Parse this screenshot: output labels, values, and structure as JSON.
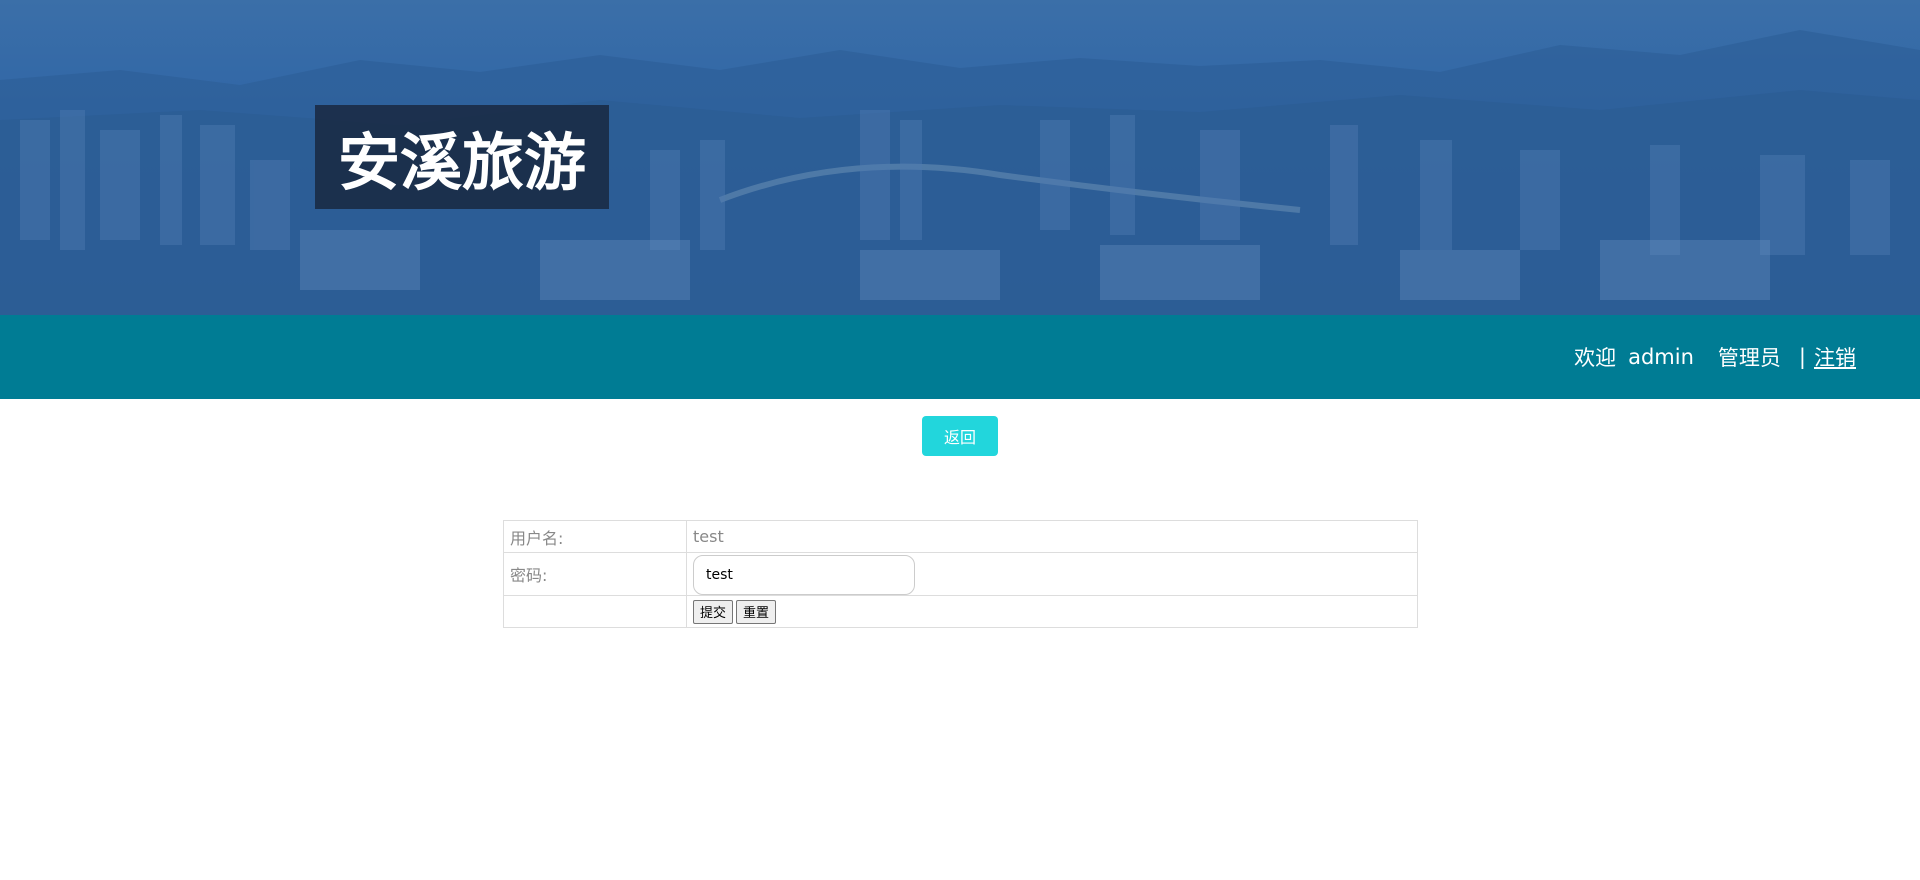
{
  "header": {
    "site_title": "安溪旅游"
  },
  "navbar": {
    "welcome_prefix": "欢迎",
    "username": "admin",
    "role": "管理员",
    "separator": "|",
    "logout_label": "注销"
  },
  "toolbar": {
    "back_label": "返回"
  },
  "form": {
    "username_label": "用户名:",
    "username_value": "test",
    "password_label": "密码:",
    "password_value": "test",
    "submit_label": "提交",
    "reset_label": "重置"
  },
  "colors": {
    "navbar": "#007c94",
    "back_button": "#22d6dc",
    "banner": "#2f65a6"
  }
}
